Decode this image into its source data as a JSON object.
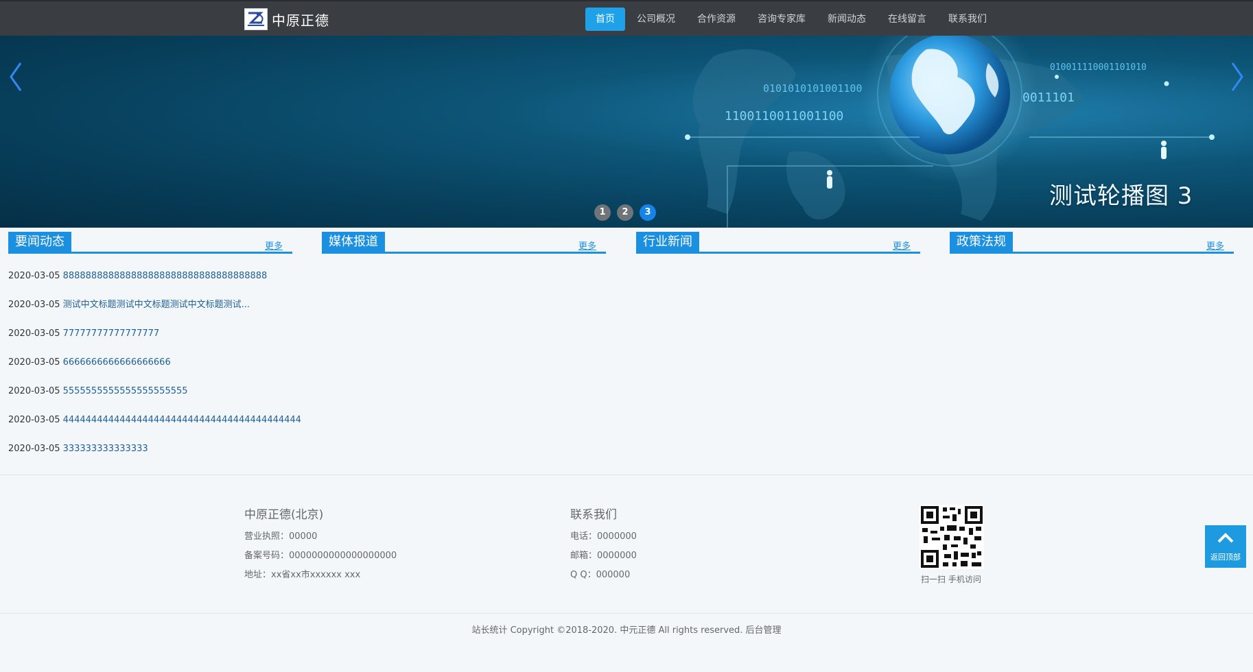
{
  "header": {
    "brand": "中原正德",
    "nav": [
      {
        "label": "首页",
        "active": true
      },
      {
        "label": "公司概况",
        "active": false
      },
      {
        "label": "合作资源",
        "active": false
      },
      {
        "label": "咨询专家库",
        "active": false
      },
      {
        "label": "新闻动态",
        "active": false
      },
      {
        "label": "在线留言",
        "active": false
      },
      {
        "label": "联系我们",
        "active": false
      }
    ]
  },
  "banner": {
    "caption": "测试轮播图 3",
    "binary_1": "0101010101001100",
    "binary_2": "1100110011001100",
    "binary_3": "010011110001101010",
    "binary_4": "0011101",
    "dots": [
      "1",
      "2",
      "3"
    ],
    "active_dot": 3
  },
  "columns": [
    {
      "title": "要闻动态",
      "more": "更多"
    },
    {
      "title": "媒体报道",
      "more": "更多"
    },
    {
      "title": "行业新闻",
      "more": "更多"
    },
    {
      "title": "政策法规",
      "more": "更多"
    }
  ],
  "news": [
    {
      "date": "2020-03-05",
      "title": "888888888888888888888888888888888888"
    },
    {
      "date": "2020-03-05",
      "title": "测试中文标题测试中文标题测试中文标题测试..."
    },
    {
      "date": "2020-03-05",
      "title": "77777777777777777"
    },
    {
      "date": "2020-03-05",
      "title": "6666666666666666666"
    },
    {
      "date": "2020-03-05",
      "title": "5555555555555555555555"
    },
    {
      "date": "2020-03-05",
      "title": "444444444444444444444444444444444444444444"
    },
    {
      "date": "2020-03-05",
      "title": "333333333333333"
    }
  ],
  "footer": {
    "company": {
      "title": "中原正德(北京)",
      "license": "营业执照：00000",
      "record": "备案号码：0000000000000000000",
      "address": "地址：xx省xx市xxxxxx xxx"
    },
    "contact": {
      "title": "联系我们",
      "phone": "电话：0000000",
      "email": "邮箱：0000000",
      "qq": "Q  Q：000000"
    },
    "qr_caption": "扫一扫 手机访问",
    "back_top": "返回顶部",
    "copyright": "站长统计 Copyright ©2018-2020. 中元正德 All rights reserved. 后台管理"
  },
  "colors": {
    "accent": "#1b8fe0",
    "nav_active": "#1ea1e8",
    "header_bg": "#3a3d42"
  }
}
